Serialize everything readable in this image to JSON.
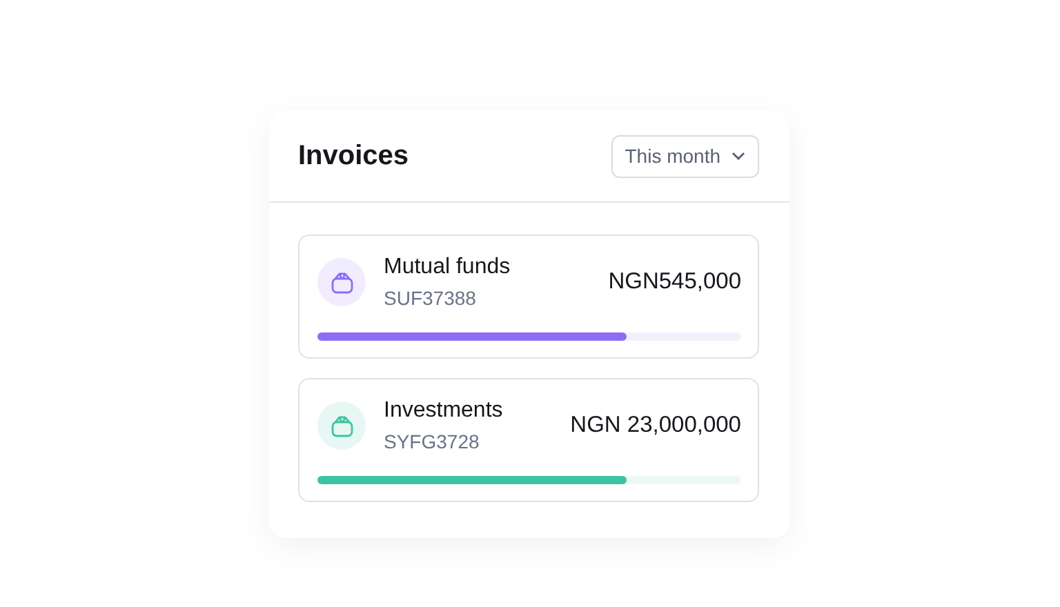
{
  "card": {
    "title": "Invoices",
    "period_select": {
      "value": "This month"
    }
  },
  "items": [
    {
      "name": "Mutual funds",
      "code": "SUF37388",
      "amount": "NGN545,000",
      "level": 0.73,
      "color": "#8e6cf5"
    },
    {
      "name": "Investments",
      "code": "SYFG3728",
      "amount": "NGN 23,000,000",
      "level": 0.73,
      "color": "#3cc4a2"
    }
  ]
}
